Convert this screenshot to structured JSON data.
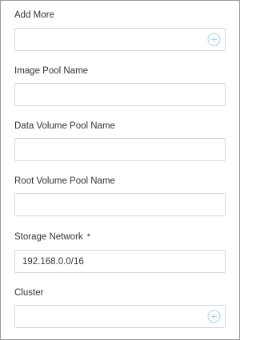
{
  "form": {
    "add_more": {
      "label": "Add More",
      "value": ""
    },
    "image_pool": {
      "label": "Image Pool Name",
      "value": ""
    },
    "data_volume_pool": {
      "label": "Data Volume Pool Name",
      "value": ""
    },
    "root_volume_pool": {
      "label": "Root Volume Pool Name",
      "value": ""
    },
    "storage_network": {
      "label": "Storage Network",
      "required_mark": "*",
      "value": "192.168.0.0/16"
    },
    "cluster": {
      "label": "Cluster",
      "value": ""
    }
  },
  "icons": {
    "add": "plus-circle-icon"
  },
  "colors": {
    "icon": "#a9d4f2",
    "border": "#d3d7dc",
    "frame": "#9a9a9a",
    "text": "#333333"
  }
}
